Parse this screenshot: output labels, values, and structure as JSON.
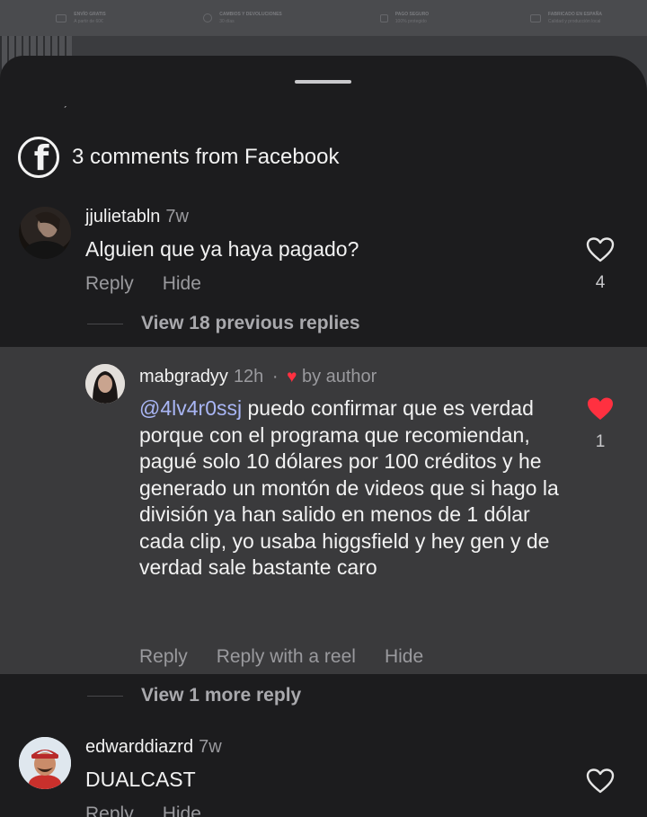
{
  "header": {
    "title": "3 comments from Facebook"
  },
  "bg_features": [
    {
      "title": "ENVÍO GRATIS",
      "sub": "A partir de 60€"
    },
    {
      "title": "CAMBIOS Y DEVOLUCIONES",
      "sub": "30 días"
    },
    {
      "title": "PAGO SEGURO",
      "sub": "100% protegido"
    },
    {
      "title": "FABRICADO EN ESPAÑA",
      "sub": "Calidad y producción local"
    }
  ],
  "comments": [
    {
      "username": "jjulietabln",
      "time": "7w",
      "text": "Alguien que ya haya pagado?",
      "actions": {
        "reply": "Reply",
        "hide": "Hide"
      },
      "likes": "4",
      "view_replies": "View 18 previous replies"
    },
    {
      "username": "mabgradyy",
      "time": "12h",
      "separator": "·",
      "by_author": "by author",
      "mention": "@4lv4r0ssj",
      "text": " puedo confirmar que es verdad porque con el programa que recomiendan, pagué solo 10 dólares por 100 créditos y he generado un montón de videos que si hago la división ya han salido en menos de 1 dólar cada clip, yo usaba higgsfield y hey gen y de verdad sale bastante caro",
      "actions": {
        "reply": "Reply",
        "reply_reel": "Reply with a reel",
        "hide": "Hide"
      },
      "likes": "1",
      "view_more": "View 1 more reply"
    },
    {
      "username": "edwarddiazrd",
      "time": "7w",
      "text": "DUALCAST",
      "actions": {
        "reply": "Reply",
        "hide": "Hide"
      }
    }
  ],
  "colors": {
    "background": "#1c1c1e",
    "reply_bg": "#3a3a3c",
    "heart_active": "#ff3040",
    "mention": "#a9b6f5"
  }
}
